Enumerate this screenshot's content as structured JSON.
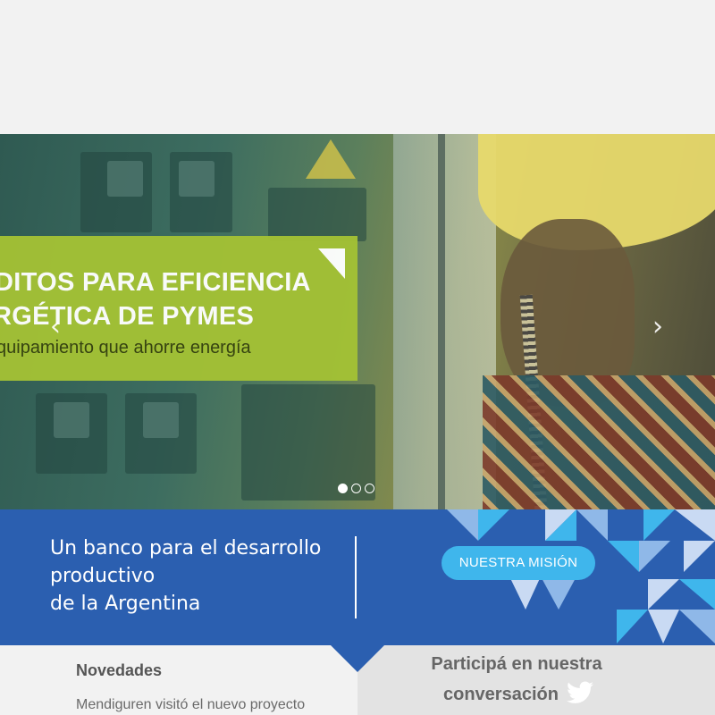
{
  "hero": {
    "promo_line1": "DITOS PARA EFICIENCIA",
    "promo_line2": "RGÉTICA DE PYMES",
    "promo_line3": "quipamiento que ahorre energía",
    "prev_arrow": "‹",
    "next_arrow": "›",
    "slides_total": 3,
    "slide_active": 1
  },
  "band": {
    "tagline_lines": [
      "Un banco para el desarrollo",
      "productivo",
      "de la Argentina"
    ],
    "mission_button": "NUESTRA MISIÓN",
    "colors": {
      "band": "#2b5fb0",
      "button": "#3fb6ec",
      "light_tri": "#8fb8e8",
      "sky_tri": "#3fb6ec"
    }
  },
  "news": {
    "heading": "Novedades",
    "first_item": "Mendiguren visitó el nuevo proyecto"
  },
  "social": {
    "line1": "Participá en nuestra",
    "line2": "conversación",
    "icon": "twitter-icon"
  }
}
